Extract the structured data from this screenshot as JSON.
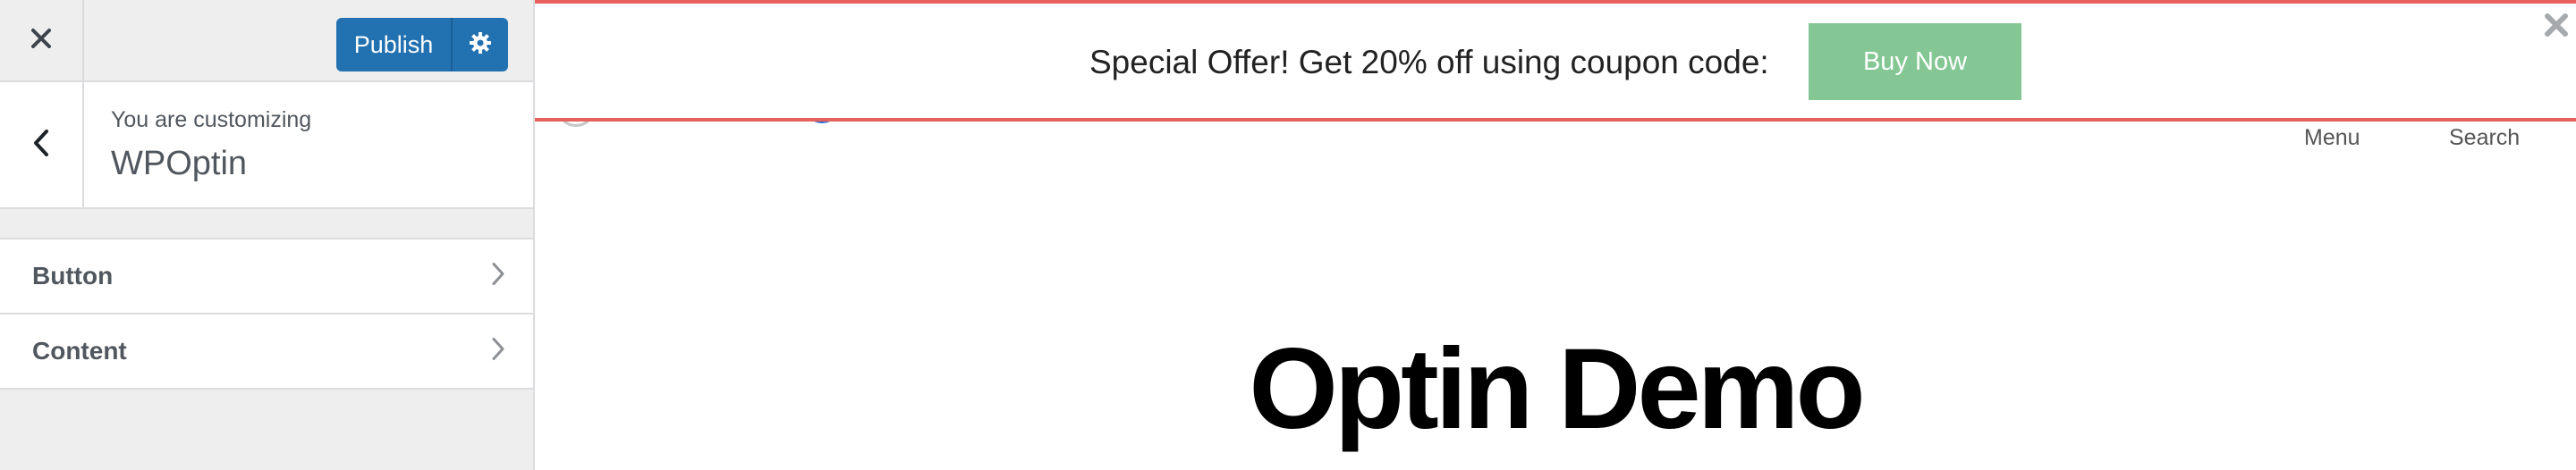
{
  "sidebar": {
    "close_icon": "close-icon",
    "publish_label": "Publish",
    "settings_icon": "gear-icon",
    "back_icon": "chevron-left-icon",
    "customizing_label": "You are customizing",
    "site_title": "WPOptin",
    "panels": [
      {
        "label": "Button",
        "icon": "chevron-right-icon"
      },
      {
        "label": "Content",
        "icon": "chevron-right-icon"
      }
    ]
  },
  "optin_bar": {
    "offer_text": "Special Offer! Get 20% off using coupon code:",
    "button_label": "Buy Now",
    "close_icon": "close-icon",
    "border_color": "#e6615e",
    "button_color": "#84c794"
  },
  "preview": {
    "nav": {
      "menu": "Menu",
      "search": "Search"
    },
    "page_title": "Optin Demo"
  },
  "colors": {
    "publish_blue": "#2271b1",
    "sidebar_bg": "#eeeeee"
  }
}
